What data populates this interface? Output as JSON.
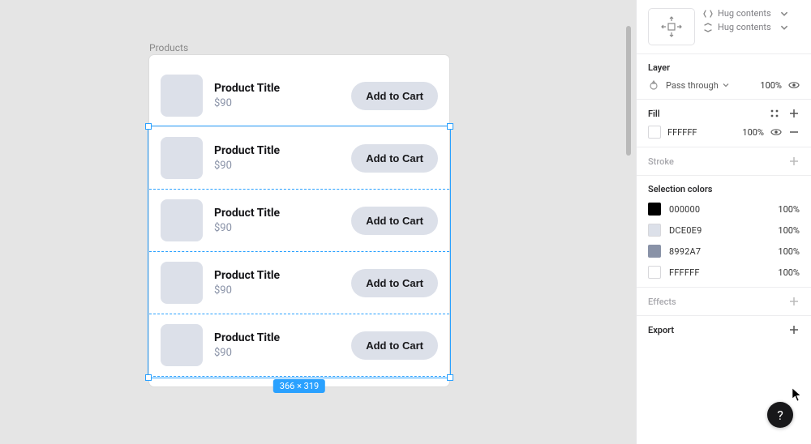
{
  "canvas": {
    "frame_label": "Products",
    "size_badge": "366 × 319",
    "products": [
      {
        "title": "Product Title",
        "price": "$90",
        "button": "Add to Cart"
      },
      {
        "title": "Product Title",
        "price": "$90",
        "button": "Add to Cart"
      },
      {
        "title": "Product Title",
        "price": "$90",
        "button": "Add to Cart"
      },
      {
        "title": "Product Title",
        "price": "$90",
        "button": "Add to Cart"
      },
      {
        "title": "Product Title",
        "price": "$90",
        "button": "Add to Cart"
      }
    ]
  },
  "inspector": {
    "auto_layout": {
      "hug_h": "Hug contents",
      "hug_v": "Hug contents"
    },
    "layer": {
      "title": "Layer",
      "mode": "Pass through",
      "opacity": "100%"
    },
    "fill": {
      "title": "Fill",
      "hex": "FFFFFF",
      "opacity": "100%"
    },
    "stroke": {
      "title": "Stroke"
    },
    "selection_colors": {
      "title": "Selection colors",
      "items": [
        {
          "hex": "000000",
          "opacity": "100%",
          "swatch": "#000000"
        },
        {
          "hex": "DCE0E9",
          "opacity": "100%",
          "swatch": "#DCE0E9"
        },
        {
          "hex": "8992A7",
          "opacity": "100%",
          "swatch": "#8992A7"
        },
        {
          "hex": "FFFFFF",
          "opacity": "100%",
          "swatch": "#FFFFFF"
        }
      ]
    },
    "effects": {
      "title": "Effects"
    },
    "export": {
      "title": "Export"
    }
  },
  "help_label": "?"
}
